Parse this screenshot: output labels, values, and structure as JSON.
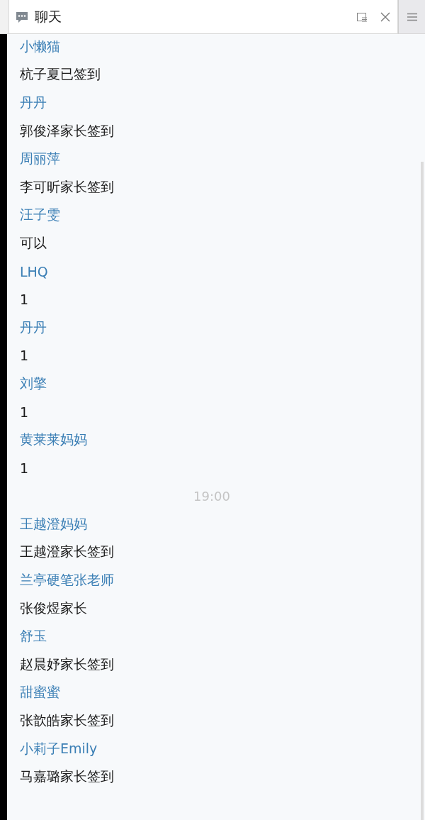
{
  "panel": {
    "title": "聊天"
  },
  "messages": [
    {
      "kind": "name",
      "text": "小懒猫"
    },
    {
      "kind": "text",
      "text": "杭子夏已签到"
    },
    {
      "kind": "name",
      "text": "丹丹"
    },
    {
      "kind": "text",
      "text": "郭俊泽家长签到"
    },
    {
      "kind": "name",
      "text": "周丽萍"
    },
    {
      "kind": "text",
      "text": "李可昕家长签到"
    },
    {
      "kind": "name",
      "text": "汪子雯"
    },
    {
      "kind": "text",
      "text": "可以"
    },
    {
      "kind": "name",
      "text": "LHQ"
    },
    {
      "kind": "text",
      "text": "1"
    },
    {
      "kind": "name",
      "text": "丹丹"
    },
    {
      "kind": "text",
      "text": "1"
    },
    {
      "kind": "name",
      "text": "刘擎"
    },
    {
      "kind": "text",
      "text": "1"
    },
    {
      "kind": "name",
      "text": "黄莱莱妈妈"
    },
    {
      "kind": "text",
      "text": "1"
    },
    {
      "kind": "time",
      "text": "19:00"
    },
    {
      "kind": "name",
      "text": "王越澄妈妈"
    },
    {
      "kind": "text",
      "text": "王越澄家长签到"
    },
    {
      "kind": "name",
      "text": "兰亭硬笔张老师"
    },
    {
      "kind": "text",
      "text": "张俊煜家长"
    },
    {
      "kind": "name",
      "text": "舒玉"
    },
    {
      "kind": "text",
      "text": "赵晨妤家长签到"
    },
    {
      "kind": "name",
      "text": "甜蜜蜜"
    },
    {
      "kind": "text",
      "text": "张歆皓家长签到"
    },
    {
      "kind": "name",
      "text": "小莉子Emily"
    },
    {
      "kind": "text",
      "text": "马嘉璐家长签到"
    }
  ]
}
